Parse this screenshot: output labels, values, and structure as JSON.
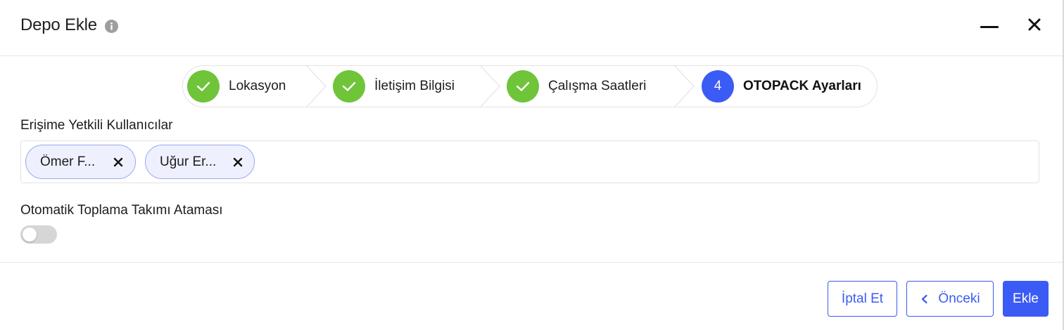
{
  "header": {
    "title": "Depo Ekle",
    "info_icon": "info-icon",
    "minimize_icon": "minus-icon",
    "close_icon": "close-icon"
  },
  "stepper": {
    "steps": [
      {
        "label": "Lokasyon",
        "status": "done",
        "icon": "check-icon"
      },
      {
        "label": "İletişim Bilgisi",
        "status": "done",
        "icon": "check-icon"
      },
      {
        "label": "Çalışma Saatleri",
        "status": "done",
        "icon": "check-icon"
      },
      {
        "label": "OTOPACK Ayarları",
        "status": "active",
        "number": "4"
      }
    ],
    "done_color": "#6fc43a",
    "active_color": "#3b5bf5"
  },
  "authorized_users": {
    "label": "Erişime Yetkili Kullanıcılar",
    "chips": [
      {
        "text": "Ömer F..."
      },
      {
        "text": "Uğur Er..."
      }
    ]
  },
  "auto_assign": {
    "label": "Otomatik Toplama Takımı Ataması",
    "enabled": false
  },
  "footer": {
    "cancel_label": "İptal Et",
    "prev_label": "Önceki",
    "add_label": "Ekle",
    "accent": "#3b5bf5"
  }
}
